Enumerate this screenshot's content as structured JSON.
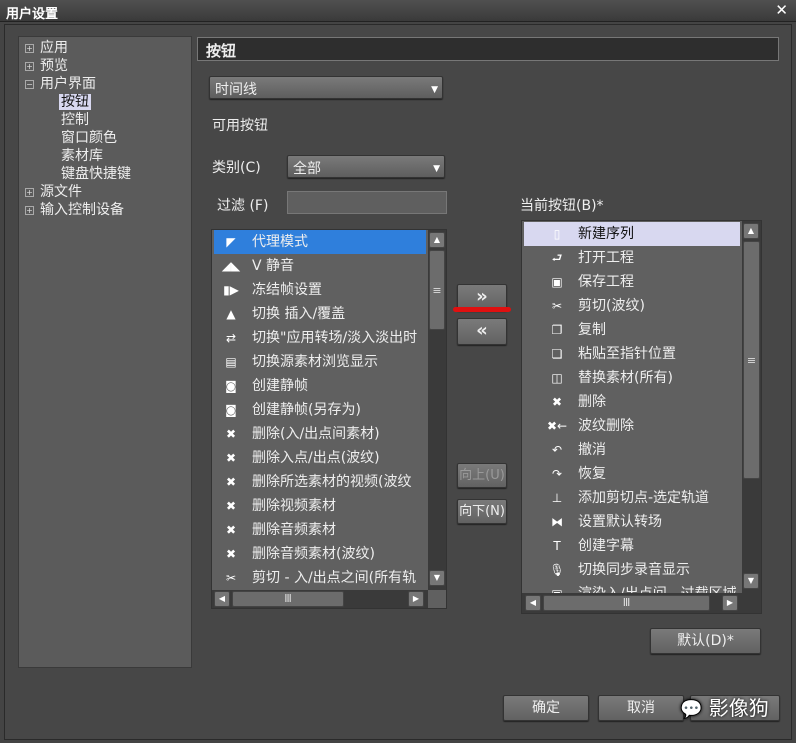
{
  "window": {
    "title": "用户设置",
    "close_icon": "close-icon"
  },
  "tree": {
    "items": [
      {
        "label": "应用",
        "expander": "+"
      },
      {
        "label": "预览",
        "expander": "+"
      },
      {
        "label": "用户界面",
        "expander": "−",
        "children": [
          "按钮",
          "控制",
          "窗口颜色",
          "素材库",
          "键盘快捷键"
        ],
        "selected_child": "按钮"
      },
      {
        "label": "源文件",
        "expander": "+"
      },
      {
        "label": "输入控制设备",
        "expander": "+"
      }
    ]
  },
  "panel": {
    "header": "按钮",
    "context_select": "时间线",
    "available_label": "可用按钮",
    "category_label": "类别(C)",
    "category_value": "全部",
    "filter_label": "过滤 (F)",
    "filter_value": "",
    "current_label": "当前按钮(B)*"
  },
  "available": [
    {
      "icon": "proxy-mode-icon",
      "glyph": "◤",
      "label": "代理模式",
      "selected": true
    },
    {
      "icon": "mute-icon",
      "glyph": "◢◣",
      "label": "V 静音"
    },
    {
      "icon": "freeze-frame-icon",
      "glyph": "▮▶",
      "label": "冻结帧设置"
    },
    {
      "icon": "insert-overwrite-icon",
      "glyph": "▲",
      "label": "切换 插入/覆盖"
    },
    {
      "icon": "transition-fade-icon",
      "glyph": "⇄",
      "label": "切换\"应用转场/淡入淡出时"
    },
    {
      "icon": "source-browser-icon",
      "glyph": "▤",
      "label": "切换源素材浏览显示"
    },
    {
      "icon": "camera-icon",
      "glyph": "◙",
      "label": "创建静帧"
    },
    {
      "icon": "camera-save-icon",
      "glyph": "◙",
      "label": "创建静帧(另存为)"
    },
    {
      "icon": "delete-inout-icon",
      "glyph": "✖",
      "label": "删除(入/出点间素材)"
    },
    {
      "icon": "delete-ripple-icon",
      "glyph": "✖",
      "label": "删除入点/出点(波纹)"
    },
    {
      "icon": "delete-video-ripple-icon",
      "glyph": "✖",
      "label": "删除所选素材的视频(波纹"
    },
    {
      "icon": "delete-video-icon",
      "glyph": "✖",
      "label": "删除视频素材"
    },
    {
      "icon": "delete-audio-icon",
      "glyph": "✖",
      "label": "删除音频素材"
    },
    {
      "icon": "delete-audio-ripple-icon",
      "glyph": "✖",
      "label": "删除音频素材(波纹)"
    },
    {
      "icon": "cut-icon",
      "glyph": "✂",
      "label": "剪切 - 入/出点之间(所有轨"
    }
  ],
  "current": [
    {
      "icon": "new-sequence-icon",
      "glyph": "▯",
      "label": "新建序列",
      "selected": true
    },
    {
      "icon": "open-project-icon",
      "glyph": "⮐",
      "label": "打开工程"
    },
    {
      "icon": "save-icon",
      "glyph": "▣",
      "label": "保存工程"
    },
    {
      "icon": "scissors-icon",
      "glyph": "✂",
      "label": "剪切(波纹)"
    },
    {
      "icon": "copy-icon",
      "glyph": "❐",
      "label": "复制"
    },
    {
      "icon": "paste-icon",
      "glyph": "❏",
      "label": "粘贴至指针位置"
    },
    {
      "icon": "replace-icon",
      "glyph": "◫",
      "label": "替换素材(所有)"
    },
    {
      "icon": "delete-icon",
      "glyph": "✖",
      "label": "删除"
    },
    {
      "icon": "ripple-delete-icon",
      "glyph": "✖←",
      "label": "波纹删除"
    },
    {
      "icon": "undo-icon",
      "glyph": "↶",
      "label": "撤消"
    },
    {
      "icon": "redo-icon",
      "glyph": "↷",
      "label": "恢复"
    },
    {
      "icon": "add-cut-icon",
      "glyph": "⊥",
      "label": "添加剪切点-选定轨道"
    },
    {
      "icon": "default-transition-icon",
      "glyph": "⧓",
      "label": "设置默认转场"
    },
    {
      "icon": "title-icon",
      "glyph": "T",
      "label": "创建字幕"
    },
    {
      "icon": "microphone-icon",
      "glyph": "🎙",
      "label": "切换同步录音显示"
    },
    {
      "icon": "render-icon",
      "glyph": "▣",
      "label": "渲染入/出点间 - 过载区域"
    }
  ],
  "buttons": {
    "add": "»",
    "remove": "«",
    "up": "向上(U)",
    "down": "向下(N)",
    "default": "默认(D)*",
    "ok": "确定",
    "cancel": "取消"
  },
  "watermark": "影像狗",
  "colors": {
    "selection": "#2f7fdc",
    "current_selection": "#d8d8f0",
    "annotation": "#e01010"
  }
}
